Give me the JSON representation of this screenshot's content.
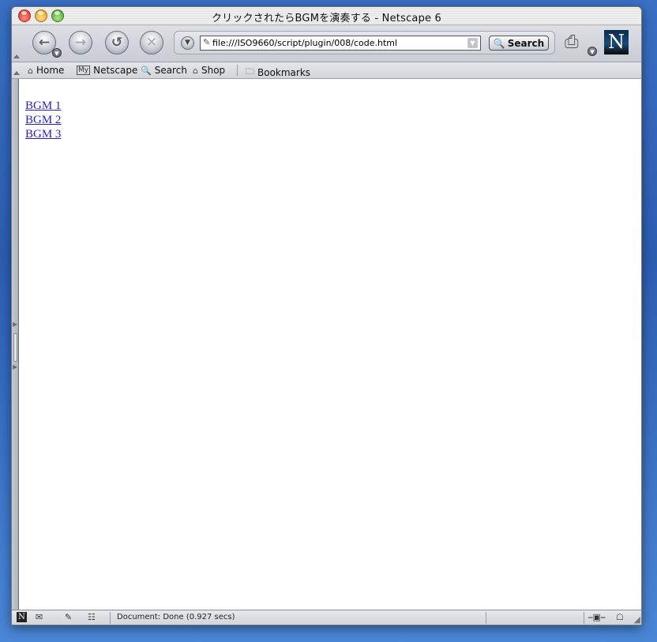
{
  "window": {
    "title": "クリックされたらBGMを演奏する - Netscape 6"
  },
  "navigation": {
    "back_icon": "back-arrow-icon",
    "forward_icon": "forward-arrow-icon",
    "reload_icon": "reload-icon",
    "stop_icon": "stop-icon",
    "url": "file:///ISO9660/script/plugin/008/code.html",
    "search_label": "Search"
  },
  "personal_toolbar": {
    "home": "Home",
    "my_badge": "My",
    "netscape": "Netscape",
    "search": "Search",
    "shop": "Shop",
    "bookmarks": "Bookmarks"
  },
  "content": {
    "links": [
      "BGM 1",
      "BGM 2",
      "BGM 3"
    ]
  },
  "status": {
    "text": "Document: Done (0.927 secs)"
  },
  "colors": {
    "link": "#2a1ecc",
    "desktop": "#2c5db3"
  }
}
